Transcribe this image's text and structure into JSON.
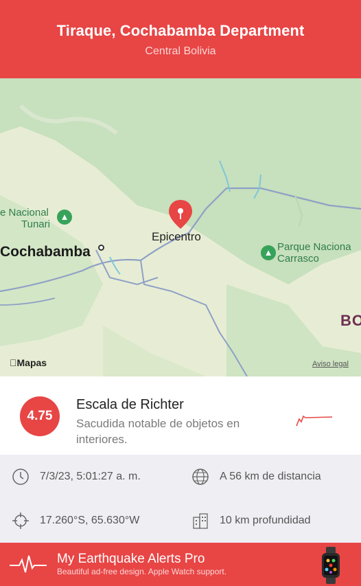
{
  "header": {
    "title": "Tiraque, Cochabamba Department",
    "subtitle": "Central Bolivia"
  },
  "map": {
    "labels": {
      "park_tunari_line1": "e Nacional",
      "park_tunari_line2": "Tunari",
      "city_cochabamba": "Cochabamba",
      "epicenter": "Epicentro",
      "park_carrasco_line1": "Parque Naciona",
      "park_carrasco_line2": "Carrasco",
      "country_fragment": "BO",
      "maps_brand": "Mapas",
      "legal": "Aviso legal"
    },
    "pin_color": "#e84545",
    "park_icon": "tree-icon"
  },
  "quake": {
    "magnitude": "4.75",
    "scale_title": "Escala de Richter",
    "scale_description": "Sacudida notable de objetos en interiores."
  },
  "details": {
    "datetime": "7/3/23, 5:01:27 a. m.",
    "distance": "A 56 km de distancia",
    "coordinates": "17.260°S, 65.630°W",
    "depth": "10 km profundidad",
    "icons": [
      "clock-icon",
      "globe-icon",
      "crosshair-icon",
      "building-icon"
    ]
  },
  "promo": {
    "title": "My Earthquake Alerts Pro",
    "subtitle": "Beautiful ad-free design. Apple Watch support.",
    "icons": [
      "heartbeat-icon",
      "apple-watch-icon"
    ]
  },
  "colors": {
    "accent": "#e84545",
    "park_green": "#37a35a",
    "map_forest": "#c9e2bf",
    "map_land": "#e6ecd2"
  }
}
